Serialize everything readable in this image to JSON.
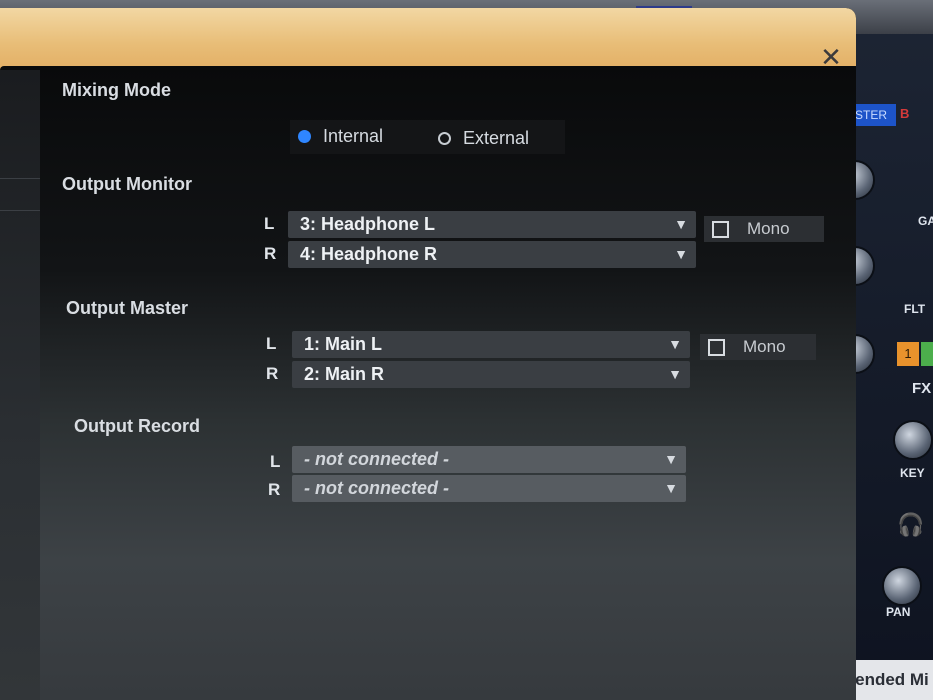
{
  "background": {
    "top_label": "",
    "master_badge": "STER",
    "deck_b_label": "B",
    "gain_label": "GA",
    "filter_label": "FLT",
    "fx_label": "FX",
    "fx_slot": "1",
    "key_label": "KEY",
    "pan_label": "PAN",
    "bottom_text": "U (Extended Mi"
  },
  "dialog": {
    "close_icon": "close-icon",
    "mixing_mode": {
      "title": "Mixing Mode",
      "options": [
        {
          "label": "Internal",
          "selected": true
        },
        {
          "label": "External",
          "selected": false
        }
      ]
    },
    "output_monitor": {
      "title": "Output Monitor",
      "left_label": "L",
      "right_label": "R",
      "left_value": "3: Headphone L",
      "right_value": "4: Headphone R",
      "mono_label": "Mono"
    },
    "output_master": {
      "title": "Output Master",
      "left_label": "L",
      "right_label": "R",
      "left_value": "1: Main L",
      "right_value": "2: Main R",
      "mono_label": "Mono"
    },
    "output_record": {
      "title": "Output Record",
      "left_label": "L",
      "right_label": "R",
      "left_value": "- not connected -",
      "right_value": "- not connected -"
    }
  },
  "colors": {
    "accent_blue": "#2f86ff",
    "title_bar": "#e8bd77"
  }
}
